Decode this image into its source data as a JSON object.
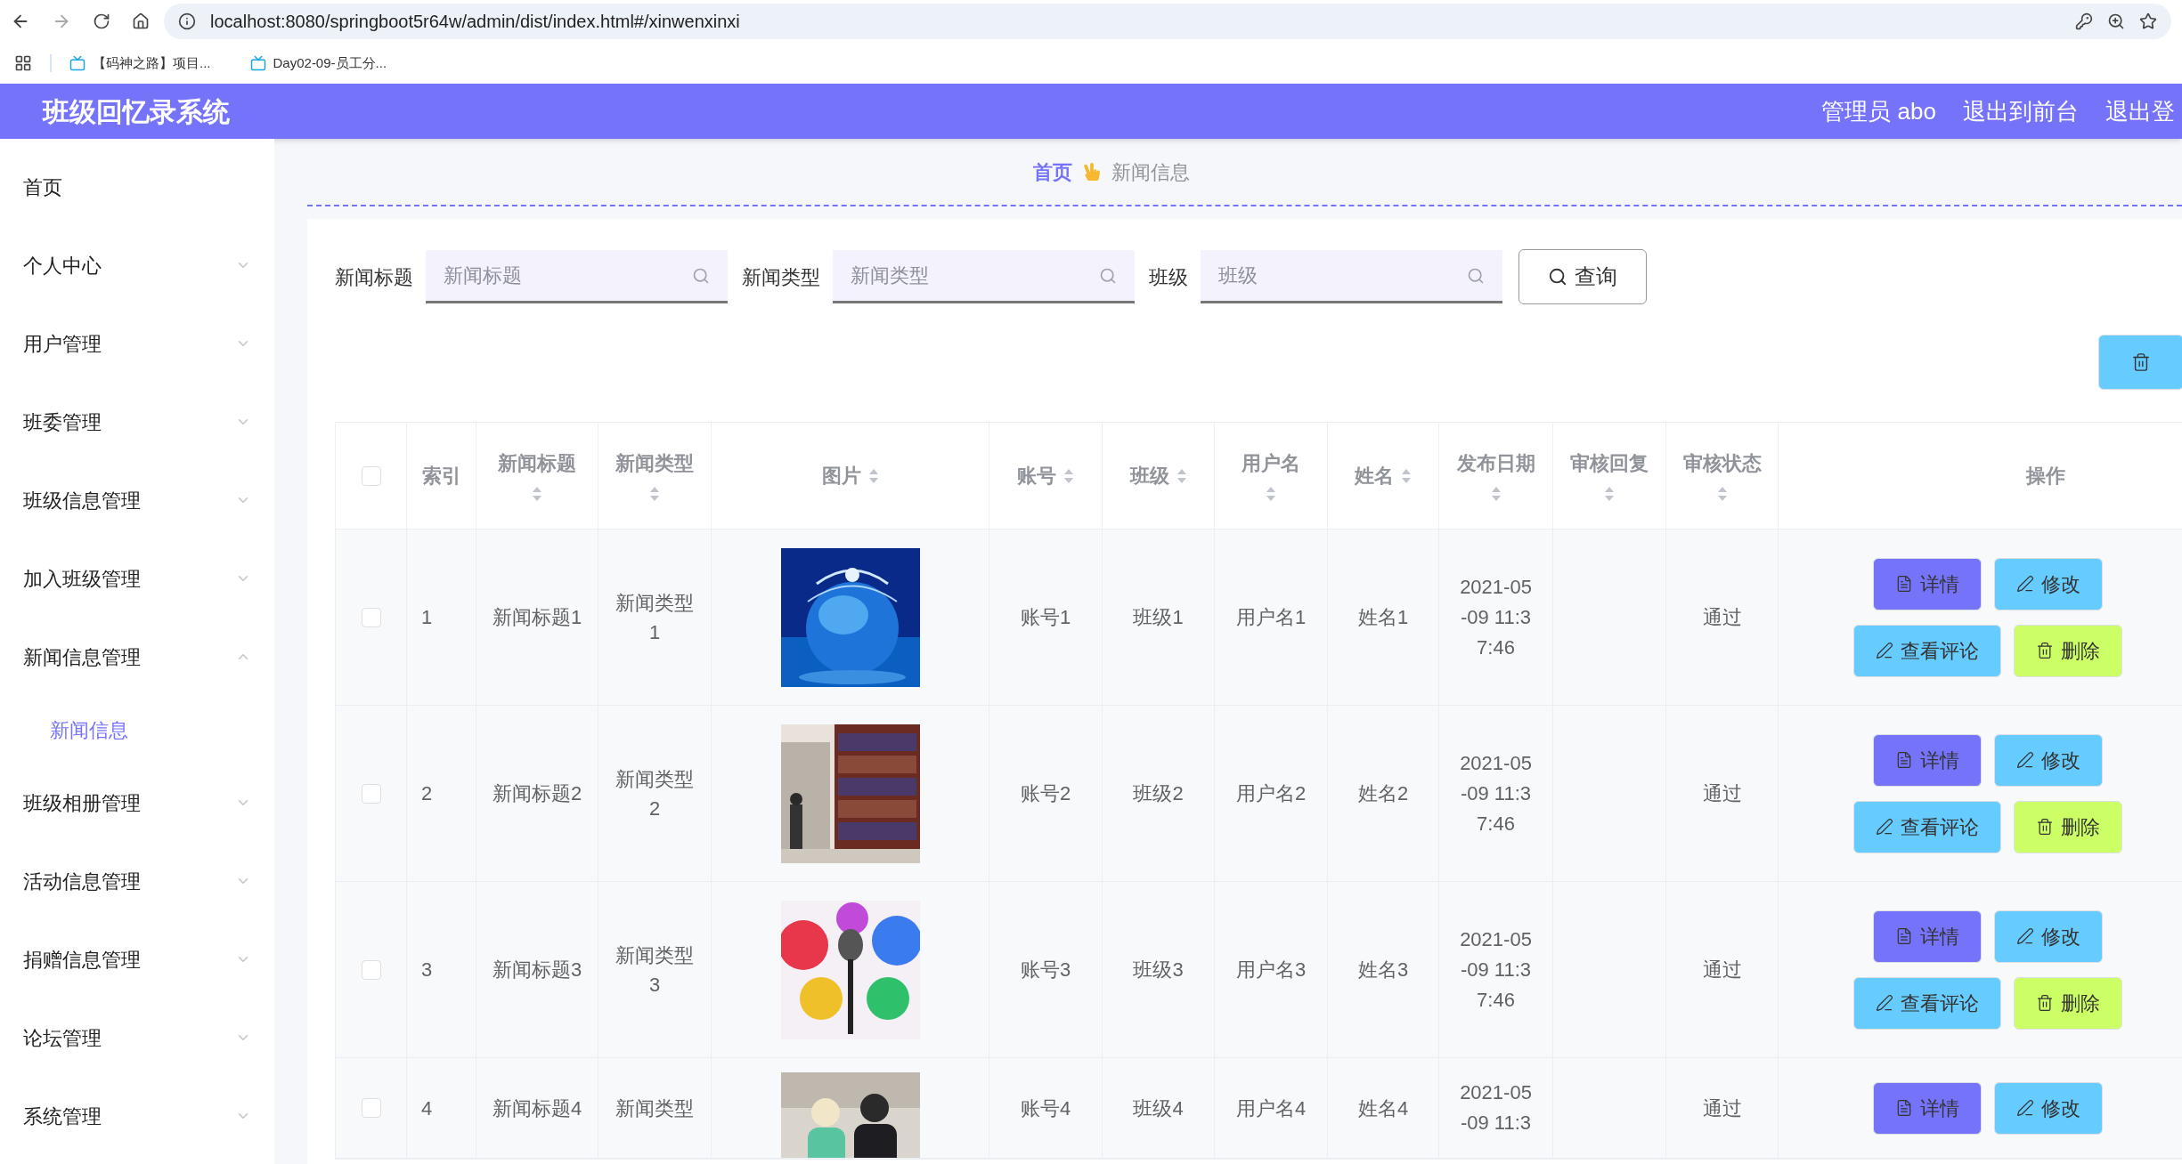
{
  "browser": {
    "url": "localhost:8080/springboot5r64w/admin/dist/index.html#/xinwenxinxi",
    "bookmarks": [
      {
        "label": "【码神之路】项目..."
      },
      {
        "label": "Day02-09-员工分..."
      }
    ]
  },
  "header": {
    "title": "班级回忆录系统",
    "links": [
      "管理员 abo",
      "退出到前台",
      "退出登"
    ]
  },
  "sidebar": {
    "items": [
      {
        "label": "首页",
        "kind": "link"
      },
      {
        "label": "个人中心",
        "kind": "menu",
        "expanded": false
      },
      {
        "label": "用户管理",
        "kind": "menu",
        "expanded": false
      },
      {
        "label": "班委管理",
        "kind": "menu",
        "expanded": false
      },
      {
        "label": "班级信息管理",
        "kind": "menu",
        "expanded": false
      },
      {
        "label": "加入班级管理",
        "kind": "menu",
        "expanded": false
      },
      {
        "label": "新闻信息管理",
        "kind": "menu",
        "expanded": true,
        "children": [
          {
            "label": "新闻信息",
            "selected": true
          }
        ]
      },
      {
        "label": "班级相册管理",
        "kind": "menu",
        "expanded": false
      },
      {
        "label": "活动信息管理",
        "kind": "menu",
        "expanded": false
      },
      {
        "label": "捐赠信息管理",
        "kind": "menu",
        "expanded": false
      },
      {
        "label": "论坛管理",
        "kind": "menu",
        "expanded": false
      },
      {
        "label": "系统管理",
        "kind": "menu",
        "expanded": false
      }
    ]
  },
  "breadcrumb": [
    {
      "label": "首页"
    },
    {
      "label": "新闻信息"
    }
  ],
  "search": {
    "fields": [
      {
        "label": "新闻标题",
        "placeholder": "新闻标题"
      },
      {
        "label": "新闻类型",
        "placeholder": "新闻类型"
      },
      {
        "label": "班级",
        "placeholder": "班级"
      }
    ],
    "button": "查询"
  },
  "table": {
    "select_all": {
      "checked": false
    },
    "columns": [
      {
        "label": "索引",
        "sortable": false
      },
      {
        "label": "新闻标题",
        "sortable": true
      },
      {
        "label": "新闻类型",
        "sortable": true
      },
      {
        "label": "图片",
        "sortable": true
      },
      {
        "label": "账号",
        "sortable": true
      },
      {
        "label": "班级",
        "sortable": true
      },
      {
        "label": "用户名",
        "sortable": true
      },
      {
        "label": "姓名",
        "sortable": true
      },
      {
        "label": "发布日期",
        "sortable": true
      },
      {
        "label": "审核回复",
        "sortable": true
      },
      {
        "label": "审核状态",
        "sortable": true
      },
      {
        "label": "操作",
        "sortable": false
      }
    ],
    "rows": [
      {
        "checked": false,
        "index": "1",
        "title": "新闻标题1",
        "type": "新闻类型1",
        "picture": {
          "kind": "globe"
        },
        "account": "账号1",
        "class": "班级1",
        "username": "用户名1",
        "name": "姓名1",
        "date": "2021-05-09 11:37:46",
        "status": "通过",
        "actions": [
          {
            "label": "详情",
            "kind": "detail"
          },
          {
            "label": "修改",
            "kind": "edit"
          },
          {
            "label": "查看评论",
            "kind": "comment"
          },
          {
            "label": "删除",
            "kind": "delete"
          }
        ]
      },
      {
        "checked": false,
        "index": "2",
        "title": "新闻标题2",
        "type": "新闻类型2",
        "picture": {
          "kind": "library"
        },
        "account": "账号2",
        "class": "班级2",
        "username": "用户名2",
        "name": "姓名2",
        "date": "2021-05-09 11:37:46",
        "status": "通过",
        "actions": [
          {
            "label": "详情",
            "kind": "detail"
          },
          {
            "label": "修改",
            "kind": "edit"
          },
          {
            "label": "查看评论",
            "kind": "comment"
          },
          {
            "label": "删除",
            "kind": "delete"
          }
        ]
      },
      {
        "checked": false,
        "index": "3",
        "title": "新闻标题3",
        "type": "新闻类型3",
        "picture": {
          "kind": "stage"
        },
        "account": "账号3",
        "class": "班级3",
        "username": "用户名3",
        "name": "姓名3",
        "date": "2021-05-09 11:37:46",
        "status": "通过",
        "actions": [
          {
            "label": "详情",
            "kind": "detail"
          },
          {
            "label": "修改",
            "kind": "edit"
          },
          {
            "label": "查看评论",
            "kind": "comment"
          },
          {
            "label": "删除",
            "kind": "delete"
          }
        ]
      },
      {
        "checked": false,
        "index": "4",
        "title": "新闻标题4",
        "type": "新闻类型",
        "picture": {
          "kind": "people"
        },
        "account": "账号4",
        "class": "班级4",
        "username": "用户名4",
        "name": "姓名4",
        "date": "2021-05-09 11:3",
        "status": "通过",
        "actions": [
          {
            "label": "详情",
            "kind": "detail"
          },
          {
            "label": "修改",
            "kind": "edit"
          }
        ]
      }
    ]
  }
}
